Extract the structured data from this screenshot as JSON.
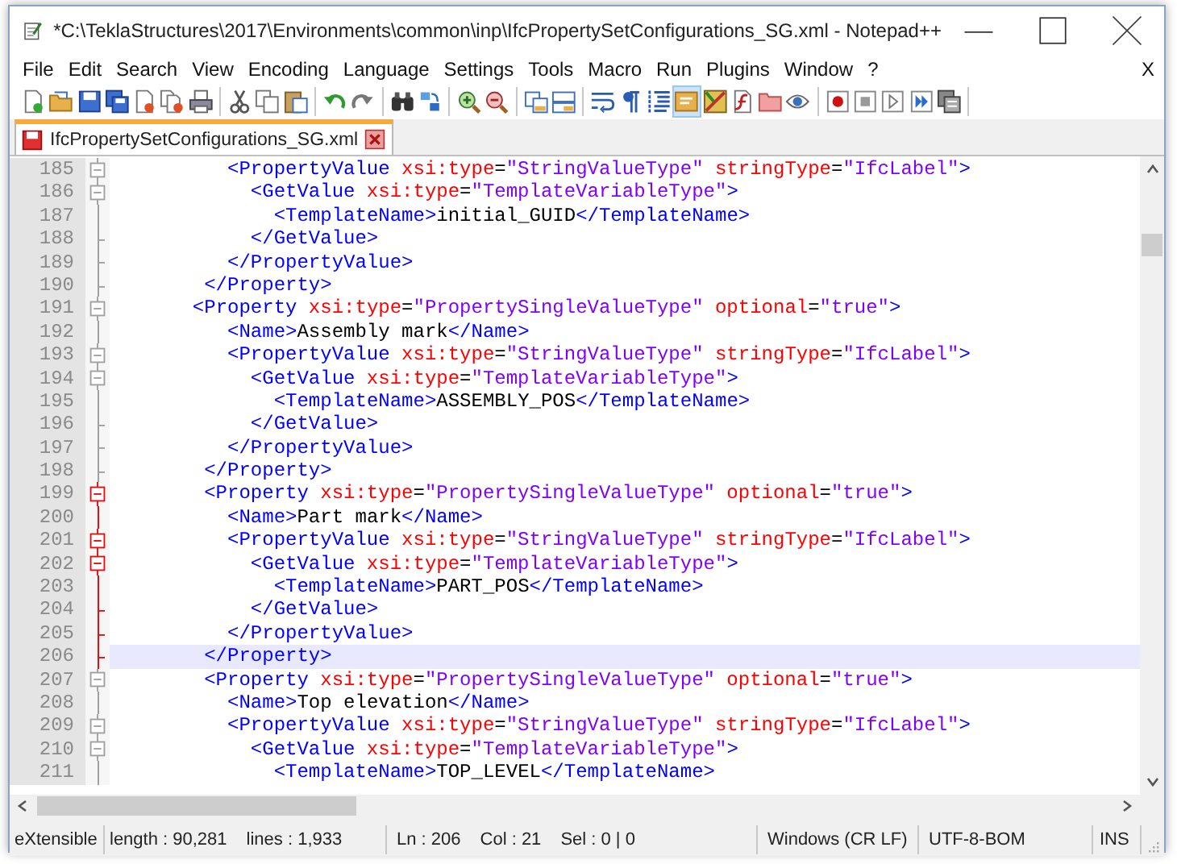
{
  "window": {
    "title": "*C:\\TeklaStructures\\2017\\Environments\\common\\inp\\IfcPropertySetConfigurations_SG.xml - Notepad++"
  },
  "menu": [
    "File",
    "Edit",
    "Search",
    "View",
    "Encoding",
    "Language",
    "Settings",
    "Tools",
    "Macro",
    "Run",
    "Plugins",
    "Window",
    "?"
  ],
  "menu_close": "X",
  "toolbar": [
    {
      "pressed": false
    },
    {
      "pressed": false
    },
    {
      "pressed": false
    },
    {
      "pressed": false
    },
    {
      "pressed": false
    },
    {
      "pressed": false
    },
    {
      "pressed": false
    },
    {
      "pressed": false
    },
    {
      "pressed": false
    },
    {
      "pressed": false
    },
    {
      "pressed": false
    },
    {
      "pressed": false
    },
    {
      "pressed": false
    },
    {
      "pressed": false
    },
    {
      "pressed": false
    },
    {
      "pressed": false
    },
    {
      "pressed": false
    },
    {
      "pressed": false
    },
    {
      "pressed": false
    },
    {
      "pressed": false
    },
    {
      "pressed": false
    },
    {
      "pressed": true
    },
    {
      "pressed": false
    },
    {
      "pressed": false
    },
    {
      "pressed": false
    },
    {
      "pressed": false
    },
    {
      "pressed": false
    },
    {
      "pressed": false
    },
    {
      "pressed": false
    },
    {
      "pressed": false
    },
    {
      "pressed": false
    }
  ],
  "tabs": [
    {
      "label": "IfcPropertySetConfigurations_SG.xml",
      "selected": true,
      "modified": true
    }
  ],
  "editor": {
    "lines": [
      {
        "number": "185",
        "foldable": true,
        "fold_end": false,
        "highlight": false,
        "current": false,
        "tokens": [
          {
            "kind": "tag",
            "text": "          <PropertyValue"
          },
          {
            "kind": "attr",
            "text": " xsi:type"
          },
          {
            "kind": "eq",
            "text": "="
          },
          {
            "kind": "value",
            "text": "\"StringValueType\""
          },
          {
            "kind": "attr",
            "text": " stringType"
          },
          {
            "kind": "eq",
            "text": "="
          },
          {
            "kind": "value",
            "text": "\"IfcLabel\""
          },
          {
            "kind": "tag",
            "text": ">"
          }
        ]
      },
      {
        "number": "186",
        "foldable": true,
        "fold_end": false,
        "highlight": false,
        "current": false,
        "tokens": [
          {
            "kind": "tag",
            "text": "            <GetValue"
          },
          {
            "kind": "attr",
            "text": " xsi:type"
          },
          {
            "kind": "eq",
            "text": "="
          },
          {
            "kind": "value",
            "text": "\"TemplateVariableType\""
          },
          {
            "kind": "tag",
            "text": ">"
          }
        ]
      },
      {
        "number": "187",
        "foldable": false,
        "fold_end": false,
        "highlight": false,
        "current": false,
        "tokens": [
          {
            "kind": "tag",
            "text": "              <TemplateName>"
          },
          {
            "kind": "text",
            "text": "initial_GUID"
          },
          {
            "kind": "tag",
            "text": "</TemplateName>"
          }
        ]
      },
      {
        "number": "188",
        "foldable": false,
        "fold_end": true,
        "highlight": false,
        "current": false,
        "tokens": [
          {
            "kind": "tag",
            "text": "            </GetValue>"
          }
        ]
      },
      {
        "number": "189",
        "foldable": false,
        "fold_end": true,
        "highlight": false,
        "current": false,
        "tokens": [
          {
            "kind": "tag",
            "text": "          </PropertyValue>"
          }
        ]
      },
      {
        "number": "190",
        "foldable": false,
        "fold_end": true,
        "highlight": false,
        "current": false,
        "tokens": [
          {
            "kind": "tag",
            "text": "        </Property>"
          }
        ]
      },
      {
        "number": "191",
        "foldable": true,
        "fold_end": false,
        "highlight": false,
        "current": false,
        "tokens": [
          {
            "kind": "tag",
            "text": "       <Property"
          },
          {
            "kind": "attr",
            "text": " xsi:type"
          },
          {
            "kind": "eq",
            "text": "="
          },
          {
            "kind": "value",
            "text": "\"PropertySingleValueType\""
          },
          {
            "kind": "attr",
            "text": " optional"
          },
          {
            "kind": "eq",
            "text": "="
          },
          {
            "kind": "value",
            "text": "\"true\""
          },
          {
            "kind": "tag",
            "text": ">"
          }
        ]
      },
      {
        "number": "192",
        "foldable": false,
        "fold_end": false,
        "highlight": false,
        "current": false,
        "tokens": [
          {
            "kind": "tag",
            "text": "          <Name>"
          },
          {
            "kind": "text",
            "text": "Assembly mark"
          },
          {
            "kind": "tag",
            "text": "</Name>"
          }
        ]
      },
      {
        "number": "193",
        "foldable": true,
        "fold_end": false,
        "highlight": false,
        "current": false,
        "tokens": [
          {
            "kind": "tag",
            "text": "          <PropertyValue"
          },
          {
            "kind": "attr",
            "text": " xsi:type"
          },
          {
            "kind": "eq",
            "text": "="
          },
          {
            "kind": "value",
            "text": "\"StringValueType\""
          },
          {
            "kind": "attr",
            "text": " stringType"
          },
          {
            "kind": "eq",
            "text": "="
          },
          {
            "kind": "value",
            "text": "\"IfcLabel\""
          },
          {
            "kind": "tag",
            "text": ">"
          }
        ]
      },
      {
        "number": "194",
        "foldable": true,
        "fold_end": false,
        "highlight": false,
        "current": false,
        "tokens": [
          {
            "kind": "tag",
            "text": "            <GetValue"
          },
          {
            "kind": "attr",
            "text": " xsi:type"
          },
          {
            "kind": "eq",
            "text": "="
          },
          {
            "kind": "value",
            "text": "\"TemplateVariableType\""
          },
          {
            "kind": "tag",
            "text": ">"
          }
        ]
      },
      {
        "number": "195",
        "foldable": false,
        "fold_end": false,
        "highlight": false,
        "current": false,
        "tokens": [
          {
            "kind": "tag",
            "text": "              <TemplateName>"
          },
          {
            "kind": "text",
            "text": "ASSEMBLY_POS"
          },
          {
            "kind": "tag",
            "text": "</TemplateName>"
          }
        ]
      },
      {
        "number": "196",
        "foldable": false,
        "fold_end": true,
        "highlight": false,
        "current": false,
        "tokens": [
          {
            "kind": "tag",
            "text": "            </GetValue>"
          }
        ]
      },
      {
        "number": "197",
        "foldable": false,
        "fold_end": true,
        "highlight": false,
        "current": false,
        "tokens": [
          {
            "kind": "tag",
            "text": "          </PropertyValue>"
          }
        ]
      },
      {
        "number": "198",
        "foldable": false,
        "fold_end": true,
        "highlight": false,
        "current": false,
        "tokens": [
          {
            "kind": "tag",
            "text": "        </Property>"
          }
        ]
      },
      {
        "number": "199",
        "foldable": true,
        "fold_end": false,
        "highlight": true,
        "current": false,
        "tokens": [
          {
            "kind": "tag",
            "text": "        <Property"
          },
          {
            "kind": "attr",
            "text": " xsi:type"
          },
          {
            "kind": "eq",
            "text": "="
          },
          {
            "kind": "value",
            "text": "\"PropertySingleValueType\""
          },
          {
            "kind": "attr",
            "text": " optional"
          },
          {
            "kind": "eq",
            "text": "="
          },
          {
            "kind": "value",
            "text": "\"true\""
          },
          {
            "kind": "tag",
            "text": ">"
          }
        ]
      },
      {
        "number": "200",
        "foldable": false,
        "fold_end": false,
        "highlight": true,
        "current": false,
        "tokens": [
          {
            "kind": "tag",
            "text": "          <Name>"
          },
          {
            "kind": "text",
            "text": "Part mark"
          },
          {
            "kind": "tag",
            "text": "</Name>"
          }
        ]
      },
      {
        "number": "201",
        "foldable": true,
        "fold_end": false,
        "highlight": true,
        "current": false,
        "tokens": [
          {
            "kind": "tag",
            "text": "          <PropertyValue"
          },
          {
            "kind": "attr",
            "text": " xsi:type"
          },
          {
            "kind": "eq",
            "text": "="
          },
          {
            "kind": "value",
            "text": "\"StringValueType\""
          },
          {
            "kind": "attr",
            "text": " stringType"
          },
          {
            "kind": "eq",
            "text": "="
          },
          {
            "kind": "value",
            "text": "\"IfcLabel\""
          },
          {
            "kind": "tag",
            "text": ">"
          }
        ]
      },
      {
        "number": "202",
        "foldable": true,
        "fold_end": false,
        "highlight": true,
        "current": false,
        "tokens": [
          {
            "kind": "tag",
            "text": "            <GetValue"
          },
          {
            "kind": "attr",
            "text": " xsi:type"
          },
          {
            "kind": "eq",
            "text": "="
          },
          {
            "kind": "value",
            "text": "\"TemplateVariableType\""
          },
          {
            "kind": "tag",
            "text": ">"
          }
        ]
      },
      {
        "number": "203",
        "foldable": false,
        "fold_end": false,
        "highlight": true,
        "current": false,
        "tokens": [
          {
            "kind": "tag",
            "text": "              <TemplateName>"
          },
          {
            "kind": "text",
            "text": "PART_POS"
          },
          {
            "kind": "tag",
            "text": "</TemplateName>"
          }
        ]
      },
      {
        "number": "204",
        "foldable": false,
        "fold_end": true,
        "highlight": true,
        "current": false,
        "tokens": [
          {
            "kind": "tag",
            "text": "            </GetValue>"
          }
        ]
      },
      {
        "number": "205",
        "foldable": false,
        "fold_end": true,
        "highlight": true,
        "current": false,
        "tokens": [
          {
            "kind": "tag",
            "text": "          </PropertyValue>"
          }
        ]
      },
      {
        "number": "206",
        "foldable": false,
        "fold_end": true,
        "highlight": true,
        "current": true,
        "tokens": [
          {
            "kind": "tag",
            "text": "        </Property>"
          }
        ]
      },
      {
        "number": "207",
        "foldable": true,
        "fold_end": false,
        "highlight": false,
        "current": false,
        "tokens": [
          {
            "kind": "tag",
            "text": "        <Property"
          },
          {
            "kind": "attr",
            "text": " xsi:type"
          },
          {
            "kind": "eq",
            "text": "="
          },
          {
            "kind": "value",
            "text": "\"PropertySingleValueType\""
          },
          {
            "kind": "attr",
            "text": " optional"
          },
          {
            "kind": "eq",
            "text": "="
          },
          {
            "kind": "value",
            "text": "\"true\""
          },
          {
            "kind": "tag",
            "text": ">"
          }
        ]
      },
      {
        "number": "208",
        "foldable": false,
        "fold_end": false,
        "highlight": false,
        "current": false,
        "tokens": [
          {
            "kind": "tag",
            "text": "          <Name>"
          },
          {
            "kind": "text",
            "text": "Top elevation"
          },
          {
            "kind": "tag",
            "text": "</Name>"
          }
        ]
      },
      {
        "number": "209",
        "foldable": true,
        "fold_end": false,
        "highlight": false,
        "current": false,
        "tokens": [
          {
            "kind": "tag",
            "text": "          <PropertyValue"
          },
          {
            "kind": "attr",
            "text": " xsi:type"
          },
          {
            "kind": "eq",
            "text": "="
          },
          {
            "kind": "value",
            "text": "\"StringValueType\""
          },
          {
            "kind": "attr",
            "text": " stringType"
          },
          {
            "kind": "eq",
            "text": "="
          },
          {
            "kind": "value",
            "text": "\"IfcLabel\""
          },
          {
            "kind": "tag",
            "text": ">"
          }
        ]
      },
      {
        "number": "210",
        "foldable": true,
        "fold_end": false,
        "highlight": false,
        "current": false,
        "tokens": [
          {
            "kind": "tag",
            "text": "            <GetValue"
          },
          {
            "kind": "attr",
            "text": " xsi:type"
          },
          {
            "kind": "eq",
            "text": "="
          },
          {
            "kind": "value",
            "text": "\"TemplateVariableType\""
          },
          {
            "kind": "tag",
            "text": ">"
          }
        ]
      },
      {
        "number": "211",
        "foldable": false,
        "fold_end": false,
        "highlight": false,
        "current": false,
        "tokens": [
          {
            "kind": "tag",
            "text": "              <TemplateName>"
          },
          {
            "kind": "text",
            "text": "TOP_LEVEL"
          },
          {
            "kind": "tag",
            "text": "</TemplateName>"
          }
        ]
      }
    ]
  },
  "status_bar": [
    {
      "items": [
        "eXtensible"
      ]
    },
    {
      "items": [
        "length : 90,281",
        "lines : 1,933"
      ]
    },
    {
      "items": [
        "Ln : 206",
        "Col : 21",
        "Sel : 0 | 0"
      ]
    },
    {
      "items": [
        "Windows (CR LF)"
      ]
    },
    {
      "items": [
        "UTF-8-BOM"
      ]
    },
    {
      "items": [
        "INS"
      ]
    }
  ]
}
